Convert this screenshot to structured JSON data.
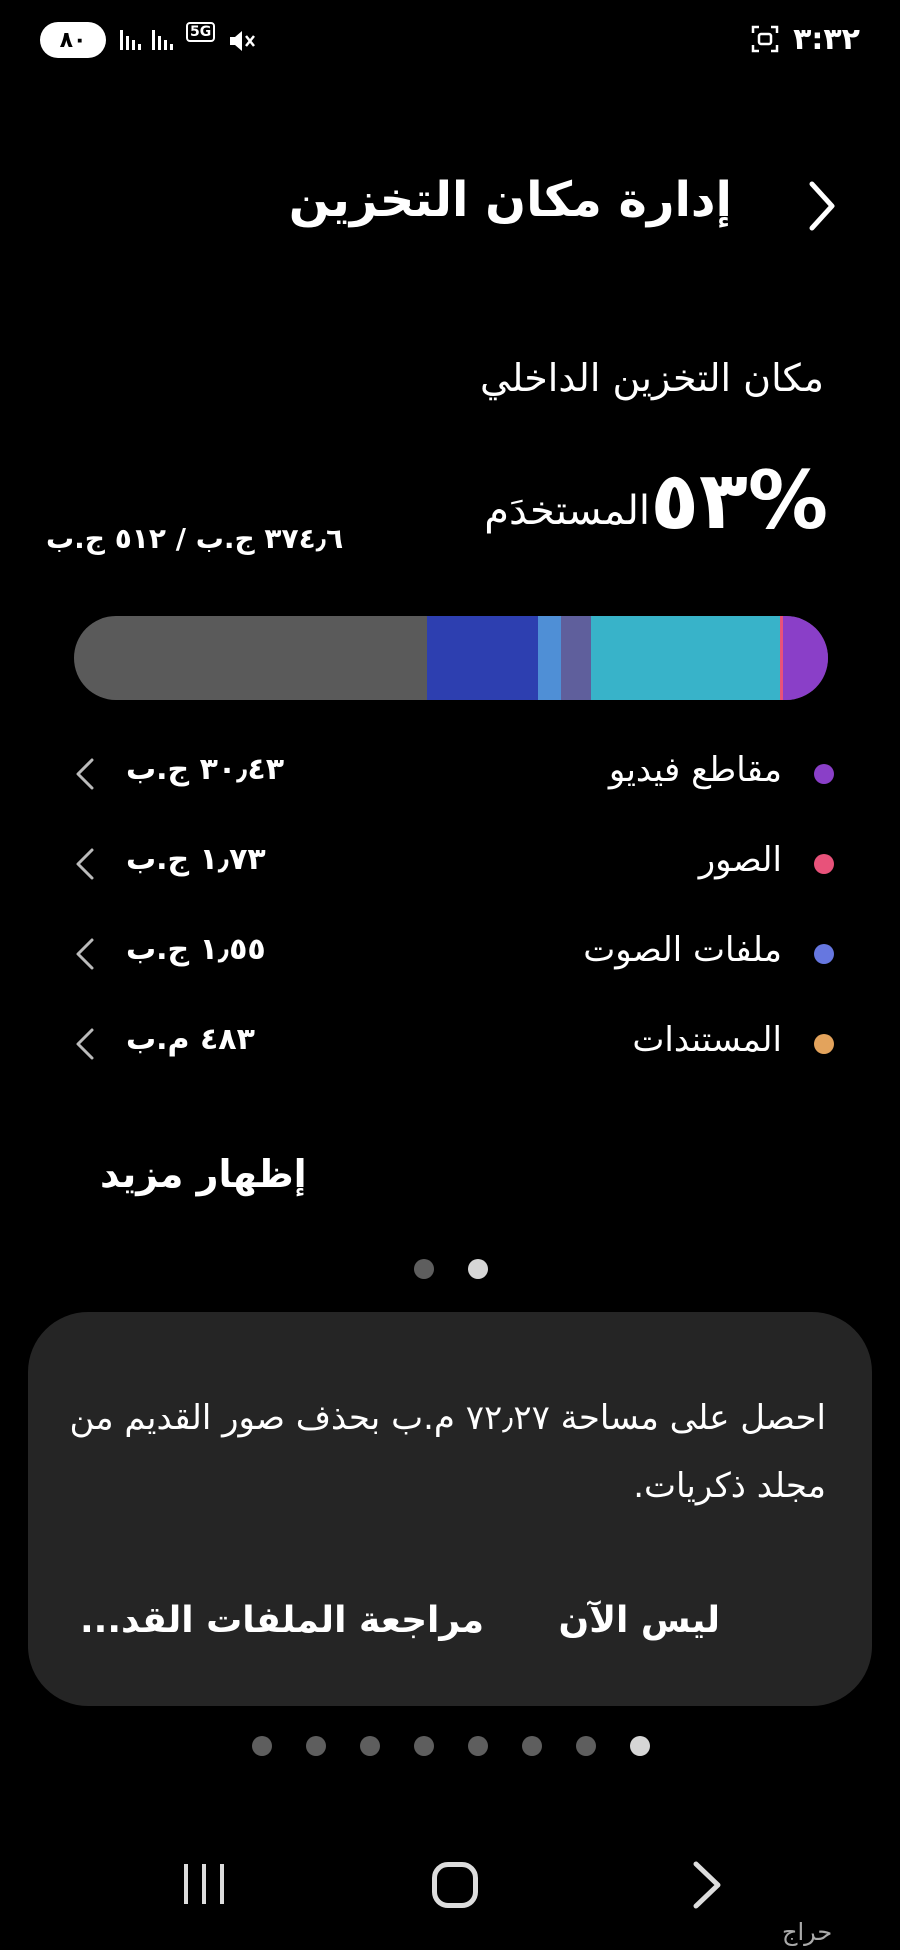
{
  "status_bar": {
    "time": "٣:٣٢",
    "battery": "٨٠",
    "network": "5G"
  },
  "header": {
    "title": "إدارة مكان التخزين"
  },
  "storage": {
    "section_title": "مكان التخزين الداخلي",
    "percent_used": "%٥٣",
    "used_label": "المستخدَم",
    "capacity": "٣٧٤٫٦ ج.ب / ٥١٢ ج.ب",
    "bar_segments": [
      {
        "color": "#8a3fc8",
        "fraction": 0.06
      },
      {
        "color": "#e8527a",
        "fraction": 0.004
      },
      {
        "color": "#38b3c9",
        "fraction": 0.25
      },
      {
        "color": "#5f5f9c",
        "fraction": 0.04
      },
      {
        "color": "#4f8fd6",
        "fraction": 0.03
      },
      {
        "color": "#2d3fb0",
        "fraction": 0.148
      }
    ],
    "bar_free_color": "#5a5a5a"
  },
  "categories": [
    {
      "label": "مقاطع فيديو",
      "value": "٣٠٫٤٣ ج.ب",
      "color": "#8a3fc8"
    },
    {
      "label": "الصور",
      "value": "١٫٧٣ ج.ب",
      "color": "#e8527a"
    },
    {
      "label": "ملفات الصوت",
      "value": "١٫٥٥ ج.ب",
      "color": "#6677e0"
    },
    {
      "label": "المستندات",
      "value": "٤٨٣ م.ب",
      "color": "#e3a35c"
    }
  ],
  "show_more_label": "إظهار مزيد",
  "suggestion_card": {
    "text": "احصل على مساحة ٧٢٫٢٧ م.ب بحذف صور القديم من مجلد ذكريات.",
    "not_now_label": "ليس الآن",
    "review_label": "مراجعة الملفات القد..."
  },
  "pager_top": {
    "count": 2,
    "active_index": 1
  },
  "pager_cards": {
    "count": 8,
    "active_index": 7
  },
  "watermark": "حراج"
}
